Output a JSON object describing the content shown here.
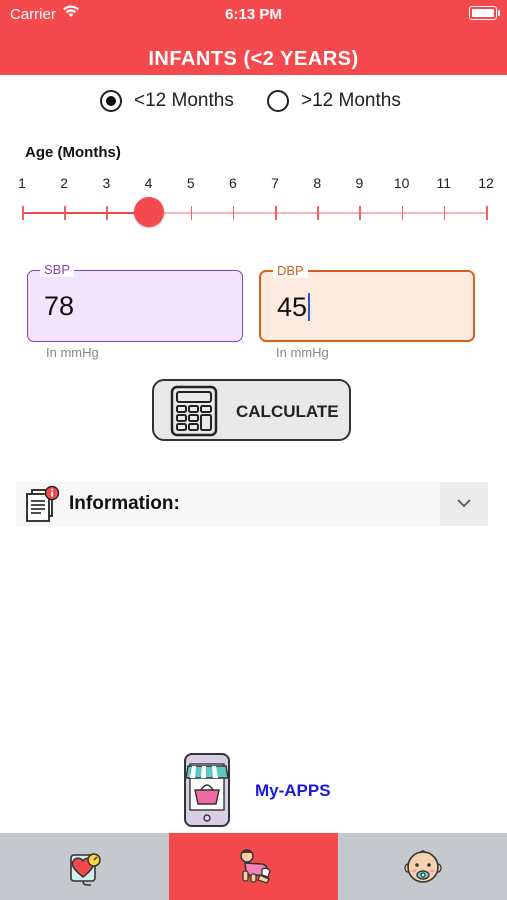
{
  "status_bar": {
    "carrier": "Carrier",
    "time": "6:13 PM"
  },
  "header": {
    "title": "INFANTS (<2 YEARS)",
    "background": "#f4494d"
  },
  "age_group": {
    "options": [
      {
        "label": "<12 Months",
        "selected": true
      },
      {
        "label": ">12 Months",
        "selected": false
      }
    ]
  },
  "age_slider": {
    "label": "Age (Months)",
    "ticks": [
      "1",
      "2",
      "3",
      "4",
      "5",
      "6",
      "7",
      "8",
      "9",
      "10",
      "11",
      "12"
    ],
    "min": 1,
    "max": 12,
    "value": 4
  },
  "sbp": {
    "label": "SBP",
    "value": "78",
    "helper": "In mmHg",
    "border_color": "#8a3fb0"
  },
  "dbp": {
    "label": "DBP",
    "value": "45",
    "helper": "In mmHg",
    "border_color": "#d6611c"
  },
  "calculate": {
    "label": "CALCULATE",
    "icon": "calculator-icon"
  },
  "information": {
    "label": "Information:",
    "icon": "document-info-icon"
  },
  "my_apps": {
    "label": "My-APPS",
    "icon": "phone-store-icon"
  },
  "tabs": [
    {
      "icon": "heart-pressure-icon",
      "active": false
    },
    {
      "icon": "crawling-baby-icon",
      "active": true
    },
    {
      "icon": "baby-face-icon",
      "active": false
    }
  ]
}
